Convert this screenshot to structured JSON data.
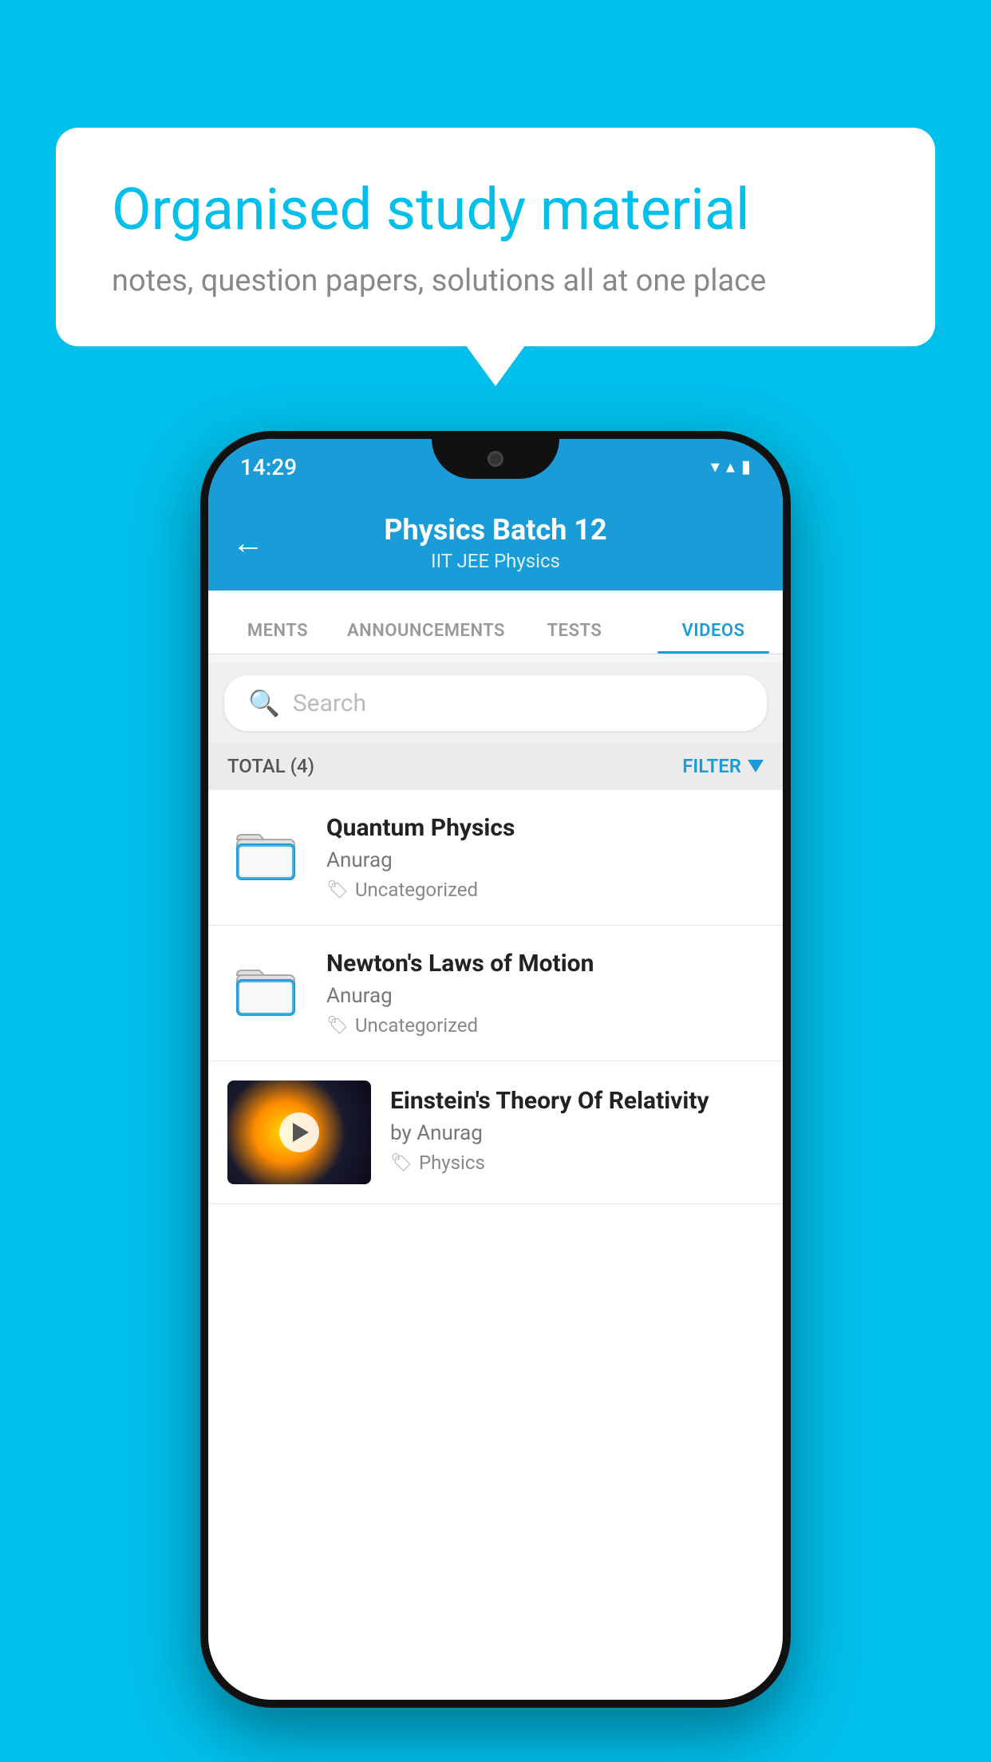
{
  "background_color": "#00BFEA",
  "bubble": {
    "title": "Organised study material",
    "subtitle": "notes, question papers, solutions all at one place"
  },
  "status_bar": {
    "time": "14:29",
    "wifi": "▾",
    "signal": "▴",
    "battery": "▮"
  },
  "header": {
    "title": "Physics Batch 12",
    "subtitle": "IIT JEE   Physics",
    "back_label": "←"
  },
  "tabs": [
    {
      "label": "MENTS",
      "active": false
    },
    {
      "label": "ANNOUNCEMENTS",
      "active": false
    },
    {
      "label": "TESTS",
      "active": false
    },
    {
      "label": "VIDEOS",
      "active": true
    }
  ],
  "search": {
    "placeholder": "Search"
  },
  "filter": {
    "total_label": "TOTAL (4)",
    "button_label": "FILTER"
  },
  "videos": [
    {
      "title": "Quantum Physics",
      "author": "Anurag",
      "tag": "Uncategorized",
      "has_thumbnail": false
    },
    {
      "title": "Newton's Laws of Motion",
      "author": "Anurag",
      "tag": "Uncategorized",
      "has_thumbnail": false
    },
    {
      "title": "Einstein's Theory Of Relativity",
      "author": "by Anurag",
      "tag": "Physics",
      "has_thumbnail": true
    }
  ]
}
